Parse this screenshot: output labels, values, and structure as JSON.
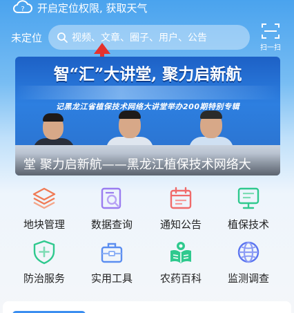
{
  "weather_bar": {
    "text": "开启定位权限, 获取天气",
    "icon": "cloud-question-icon"
  },
  "header": {
    "location": "未定位",
    "search_placeholder": "视频、文章、圈子、用户、公告",
    "scan_label": "扫一扫"
  },
  "banner": {
    "title": "智“汇”大讲堂, 聚力启新航",
    "subtitle": "记黑龙江省植保技术网络大讲堂举办200期特别专辑",
    "caption": "堂 聚力启新航——黑龙江植保技术网络大"
  },
  "grid": [
    {
      "label": "地块管理",
      "icon": "layers-icon",
      "color": "#f07a55"
    },
    {
      "label": "数据查询",
      "icon": "search-document-icon",
      "color": "#9a7cf0"
    },
    {
      "label": "通知公告",
      "icon": "calendar-icon",
      "color": "#f06a6a"
    },
    {
      "label": "植保技术",
      "icon": "monitor-icon",
      "color": "#2fc98e"
    },
    {
      "label": "防治服务",
      "icon": "shield-plus-icon",
      "color": "#2fc98e"
    },
    {
      "label": "实用工具",
      "icon": "toolbox-icon",
      "color": "#5a8df0"
    },
    {
      "label": "农药百科",
      "icon": "book-leaf-icon",
      "color": "#2fc98e"
    },
    {
      "label": "监测调查",
      "icon": "globe-icon",
      "color": "#5a74f0"
    }
  ],
  "colors": {
    "accent": "#3b8ef0",
    "arrow": "#e5322d"
  }
}
